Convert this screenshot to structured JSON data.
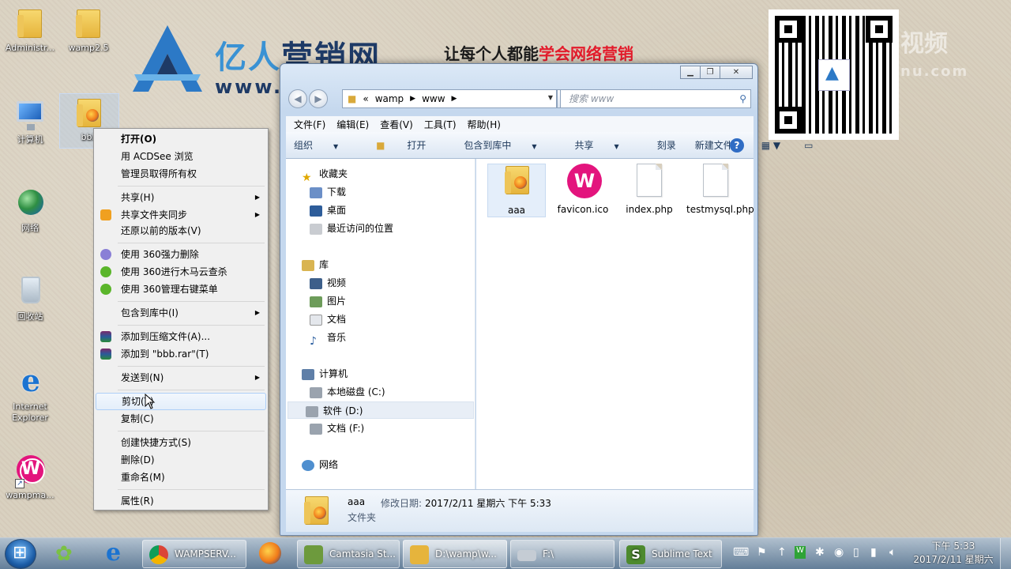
{
  "desktop": {
    "icons": [
      {
        "label": "Administr...",
        "icon": "user-folder-icon"
      },
      {
        "label": "wamp2.5",
        "icon": "wamp-folder-icon"
      },
      {
        "label": "计算机",
        "icon": "computer-icon"
      },
      {
        "label": "bbb",
        "icon": "folder-icon"
      },
      {
        "label": "网络",
        "icon": "network-icon"
      },
      {
        "label": "回收站",
        "icon": "recycle-bin-icon"
      },
      {
        "label": "Internet Explorer",
        "icon": "ie-icon"
      },
      {
        "label": "wampma...",
        "icon": "wampserver-icon"
      }
    ]
  },
  "banner": {
    "name_a": "亿人",
    "name_b": "营销网",
    "url": "www.y",
    "slogan_a": "让每个人都能",
    "slogan_b": "学会网络营销",
    "watermark": "视频",
    "watermark2": "nu.com",
    "accent": "#e31c2c",
    "brand": "#3a92d4"
  },
  "explorer": {
    "address": {
      "chevron": "«",
      "segments": [
        "wamp",
        "www"
      ]
    },
    "search_placeholder": "搜索 www",
    "menu": [
      "文件(F)",
      "编辑(E)",
      "查看(V)",
      "工具(T)",
      "帮助(H)"
    ],
    "commands": [
      "组织",
      "打开",
      "包含到库中",
      "共享",
      "刻录",
      "新建文件夹"
    ],
    "nav": {
      "favorites": "收藏夹",
      "fav_items": [
        "下载",
        "桌面",
        "最近访问的位置"
      ],
      "libraries": "库",
      "lib_items": [
        "视频",
        "图片",
        "文档",
        "音乐"
      ],
      "computer": "计算机",
      "drives": [
        "本地磁盘 (C:)",
        "软件 (D:)",
        "文档 (F:)"
      ],
      "network": "网络"
    },
    "files": [
      {
        "name": "aaa",
        "icon": "folder-icon"
      },
      {
        "name": "favicon.ico",
        "icon": "wampserver-icon"
      },
      {
        "name": "index.php",
        "icon": "document-icon"
      },
      {
        "name": "testmysql.php",
        "icon": "document-icon"
      }
    ],
    "details": {
      "name": "aaa",
      "modified_label": "修改日期:",
      "modified_value": "2017/2/11 星期六 下午 5:33",
      "type": "文件夹"
    }
  },
  "context_menu": {
    "items": [
      {
        "label": "打开(O)"
      },
      {
        "label": "用 ACDSee 浏览"
      },
      {
        "label": "管理员取得所有权"
      },
      {
        "label": "共享(H)"
      },
      {
        "label": "共享文件夹同步"
      },
      {
        "label": "还原以前的版本(V)"
      },
      {
        "label": "使用 360强力删除"
      },
      {
        "label": "使用 360进行木马云查杀"
      },
      {
        "label": "使用 360管理右键菜单"
      },
      {
        "label": "包含到库中(I)"
      },
      {
        "label": "添加到压缩文件(A)..."
      },
      {
        "label": "添加到 \"bbb.rar\"(T)"
      },
      {
        "label": "发送到(N)"
      },
      {
        "label": "剪切(T)"
      },
      {
        "label": "复制(C)"
      },
      {
        "label": "创建快捷方式(S)"
      },
      {
        "label": "删除(D)"
      },
      {
        "label": "重命名(M)"
      },
      {
        "label": "属性(R)"
      }
    ]
  },
  "taskbar": {
    "buttons": [
      {
        "label": "WAMPSERV...",
        "icon": "chrome-icon"
      },
      {
        "label": "Camtasia St...",
        "icon": "camtasia-icon"
      },
      {
        "label": "D:\\wamp\\w...",
        "icon": "folder-icon"
      },
      {
        "label": "F:\\",
        "icon": "drive-icon"
      },
      {
        "label": "Sublime Text",
        "icon": "sublime-icon"
      }
    ],
    "clock_time": "下午 5:33",
    "clock_date": "2017/2/11 星期六"
  }
}
